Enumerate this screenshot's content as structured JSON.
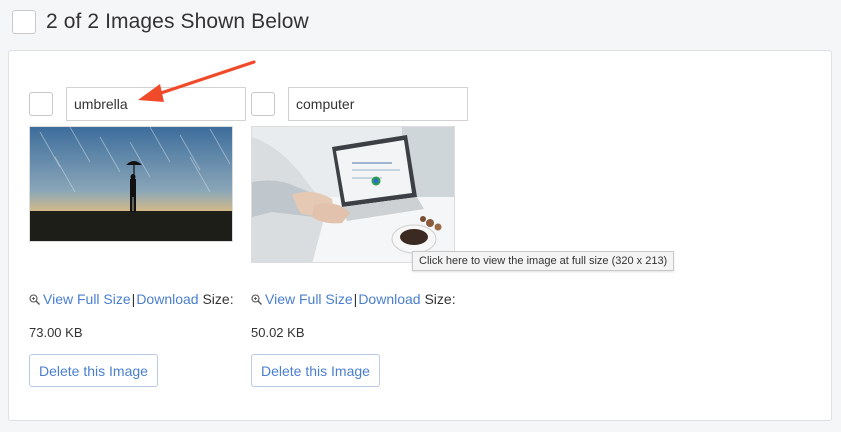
{
  "header": {
    "title": "2 of 2 Images Shown Below"
  },
  "images": [
    {
      "name": "umbrella",
      "view_label": "View Full Size",
      "separator": "|",
      "download_label": "Download",
      "size_label": "Size:",
      "size_value": "73.00 KB",
      "delete_label": "Delete this Image",
      "thumb_icon": "umbrella-photo"
    },
    {
      "name": "computer",
      "view_label": "View Full Size",
      "separator": "|",
      "download_label": "Download",
      "size_label": "Size:",
      "size_value": "50.02 KB",
      "delete_label": "Delete this Image",
      "thumb_icon": "computer-photo"
    }
  ],
  "tooltip": {
    "text": "Click here to view the image at full size (320 x 213)"
  },
  "colors": {
    "link": "#4a7fcf",
    "annotation_arrow": "#f04a2b"
  }
}
